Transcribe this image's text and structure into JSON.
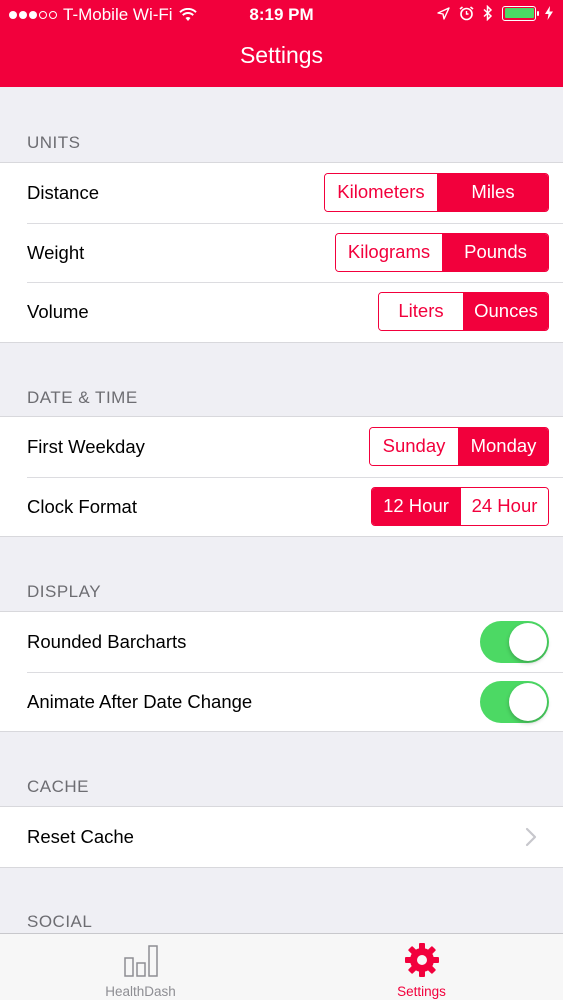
{
  "status_bar": {
    "carrier": "T-Mobile Wi-Fi",
    "time": "8:19 PM"
  },
  "nav": {
    "title": "Settings"
  },
  "colors": {
    "accent": "#f2003c",
    "toggle_on": "#4cd964",
    "battery": "#4cd964",
    "inactive_tab": "#8e8e93"
  },
  "sections": {
    "units": {
      "header": "UNITS",
      "rows": [
        {
          "label": "Distance",
          "options": [
            "Kilometers",
            "Miles"
          ],
          "selected": "Miles"
        },
        {
          "label": "Weight",
          "options": [
            "Kilograms",
            "Pounds"
          ],
          "selected": "Pounds"
        },
        {
          "label": "Volume",
          "options": [
            "Liters",
            "Ounces"
          ],
          "selected": "Ounces"
        }
      ]
    },
    "date_time": {
      "header": "DATE & TIME",
      "rows": [
        {
          "label": "First Weekday",
          "options": [
            "Sunday",
            "Monday"
          ],
          "selected": "Monday"
        },
        {
          "label": "Clock Format",
          "options": [
            "12 Hour",
            "24 Hour"
          ],
          "selected": "12 Hour"
        }
      ]
    },
    "display": {
      "header": "DISPLAY",
      "rows": [
        {
          "label": "Rounded Barcharts",
          "on": true
        },
        {
          "label": "Animate After Date Change",
          "on": true
        }
      ]
    },
    "cache": {
      "header": "CACHE",
      "rows": [
        {
          "label": "Reset Cache",
          "icon": "chevron-right-icon"
        }
      ]
    },
    "social": {
      "header": "SOCIAL"
    }
  },
  "tab_bar": {
    "tabs": [
      {
        "label": "HealthDash",
        "icon": "bar-chart-icon",
        "selected": false
      },
      {
        "label": "Settings",
        "icon": "gear-icon",
        "selected": true
      }
    ]
  }
}
